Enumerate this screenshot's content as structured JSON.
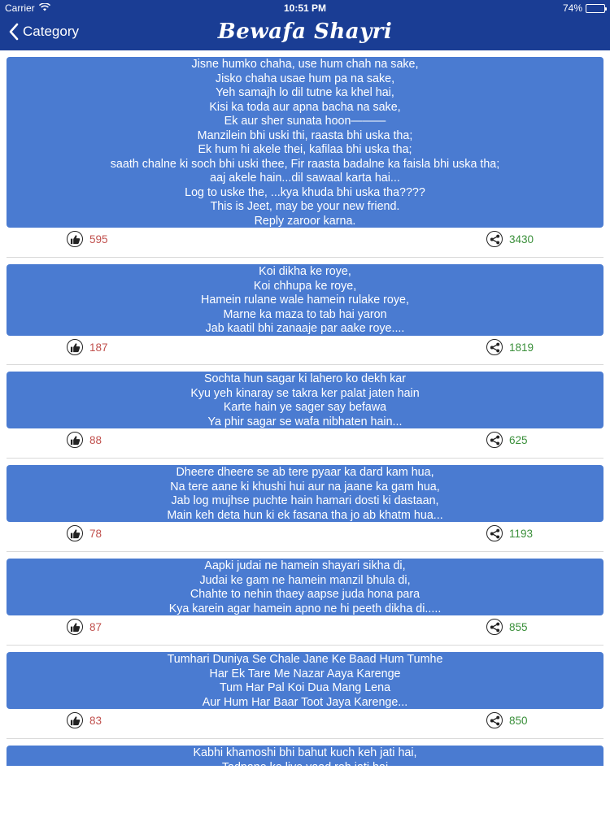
{
  "status_bar": {
    "carrier": "Carrier",
    "time": "10:51 PM",
    "battery": "74%",
    "battery_level": 0.74
  },
  "nav": {
    "back_label": "Category",
    "title": "Bewafa Shayri"
  },
  "colors": {
    "nav_bg": "#1a3d94",
    "card_bg": "#4a7bd1",
    "like_count": "#c0504d",
    "share_count": "#3a8f3a"
  },
  "posts": [
    {
      "lines": [
        "Jisne humko chaha, use hum chah na sake,",
        "Jisko chaha usae hum pa na sake,",
        "Yeh samajh lo dil tutne ka khel hai,",
        "Kisi ka toda aur apna bacha na sake,",
        "Ek aur sher sunata hoon———",
        "Manzilein bhi uski thi, raasta bhi uska tha;",
        "Ek hum hi akele thei, kafilaa bhi uska tha;",
        "saath chalne ki soch bhi uski thee, Fir raasta badalne ka faisla bhi uska tha;",
        "aaj akele hain...dil sawaal karta hai...",
        "Log to uske the, ...kya khuda bhi uska tha????",
        "This is Jeet, may be your new friend.",
        "Reply zaroor karna."
      ],
      "likes": "595",
      "shares": "3430"
    },
    {
      "lines": [
        "Koi dikha ke roye,",
        "Koi chhupa ke roye,",
        "Hamein rulane wale hamein rulake roye,",
        "Marne ka maza to tab hai yaron",
        "Jab kaatil bhi zanaaje par aake roye...."
      ],
      "likes": "187",
      "shares": "1819"
    },
    {
      "lines": [
        "Sochta hun sagar ki lahero ko dekh kar",
        "Kyu yeh kinaray se takra ker palat jaten hain",
        "Karte hain ye sager say befawa",
        "Ya phir sagar se wafa nibhaten hain..."
      ],
      "likes": "88",
      "shares": "625"
    },
    {
      "lines": [
        "Dheere dheere se ab tere pyaar ka dard kam hua,",
        "Na tere aane ki khushi hui aur na jaane ka gam hua,",
        "Jab log mujhse puchte hain hamari dosti ki dastaan,",
        "Main keh deta hun ki ek fasana tha jo ab khatm hua..."
      ],
      "likes": "78",
      "shares": "1193"
    },
    {
      "lines": [
        "Aapki judai ne hamein shayari sikha di,",
        "Judai ke gam ne hamein manzil bhula di,",
        "Chahte to nehin thaey aapse juda hona para",
        "Kya karein agar hamein apno ne hi peeth dikha di....."
      ],
      "likes": "87",
      "shares": "855"
    },
    {
      "lines": [
        "Tumhari Duniya Se Chale Jane Ke Baad Hum Tumhe",
        "Har Ek Tare Me Nazar Aaya Karenge",
        "Tum Har Pal Koi Dua Mang Lena",
        "Aur Hum Har Baar Toot Jaya Karenge..."
      ],
      "likes": "83",
      "shares": "850"
    },
    {
      "lines": [
        "Kabhi khamoshi bhi bahut kuch keh jati hai,",
        "Tadpane ke liye yaad reh jati hai"
      ],
      "likes": "",
      "shares": ""
    }
  ]
}
